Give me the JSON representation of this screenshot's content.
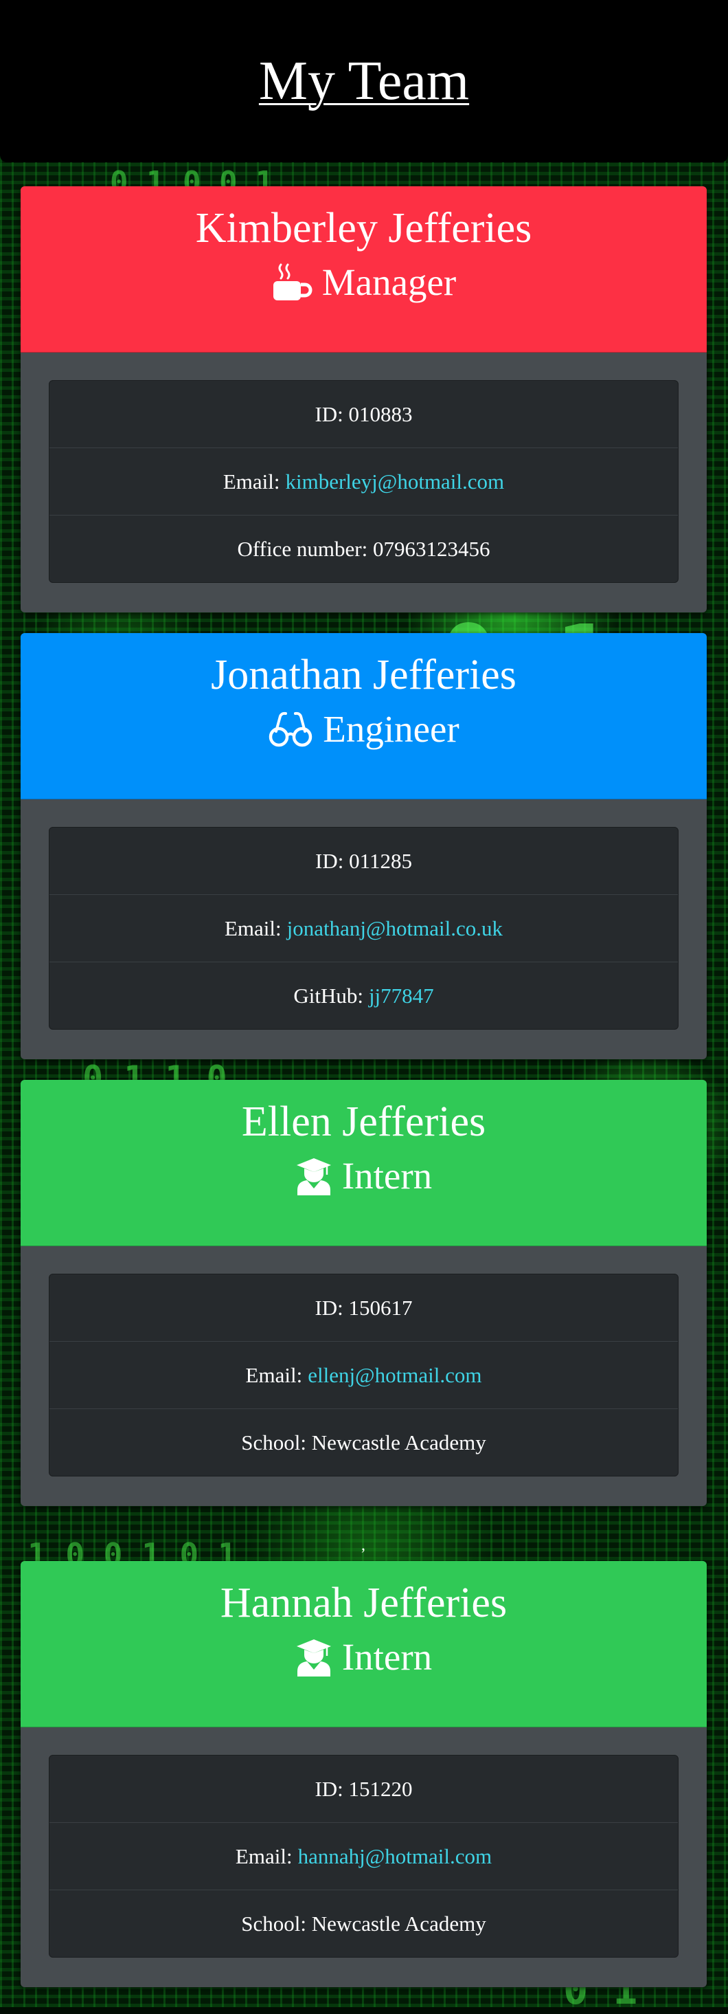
{
  "page": {
    "title": "My Team"
  },
  "colors": {
    "manager": "#fd3044",
    "engineer": "#0090fa",
    "intern": "#30c956",
    "card_body": "#474c50",
    "list_bg": "#262a2d",
    "link": "#3fd4e6"
  },
  "team": [
    {
      "name": "Kimberley Jefferies",
      "role": "Manager",
      "icon": "mug-hot-icon",
      "id_label": "ID:",
      "id": "010883",
      "email_label": "Email:",
      "email": "kimberleyj@hotmail.com",
      "extra_label": "Office number:",
      "extra_value": "07963123456"
    },
    {
      "name": "Jonathan Jefferies",
      "role": "Engineer",
      "icon": "glasses-icon",
      "id_label": "ID:",
      "id": "011285",
      "email_label": "Email:",
      "email": "jonathanj@hotmail.co.uk",
      "extra_label": "GitHub:",
      "extra_value": "jj77847"
    },
    {
      "name": "Ellen Jefferies",
      "role": "Intern",
      "icon": "graduate-icon",
      "id_label": "ID:",
      "id": "150617",
      "email_label": "Email:",
      "email": "ellenj@hotmail.com",
      "extra_label": "School:",
      "extra_value": "Newcastle Academy"
    },
    {
      "name": "Hannah Jefferies",
      "role": "Intern",
      "icon": "graduate-icon",
      "id_label": "ID:",
      "id": "151220",
      "email_label": "Email:",
      "email": "hannahj@hotmail.com",
      "extra_label": "School:",
      "extra_value": "Newcastle Academy"
    }
  ],
  "separator": ","
}
